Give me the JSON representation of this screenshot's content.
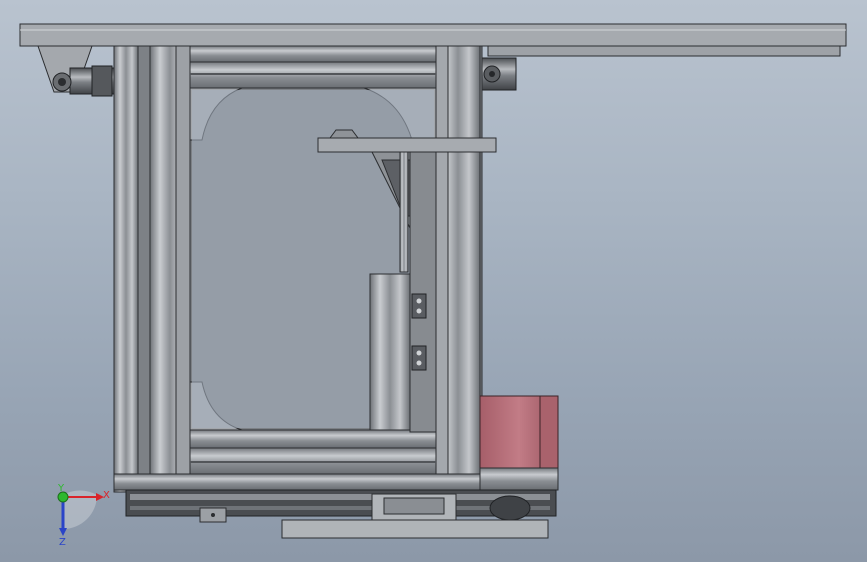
{
  "viewport": {
    "view": "front",
    "background_top": "#b9c3cf",
    "background_bottom": "#8c98a8"
  },
  "model": {
    "frame_color": "#9a9ea3",
    "motor_color": "#b5707a"
  },
  "triad": {
    "x_label": "X",
    "y_label": "Y",
    "z_label": "Z",
    "x_color": "#d9232a",
    "y_color": "#2eb82e",
    "z_color": "#2a44c8"
  }
}
